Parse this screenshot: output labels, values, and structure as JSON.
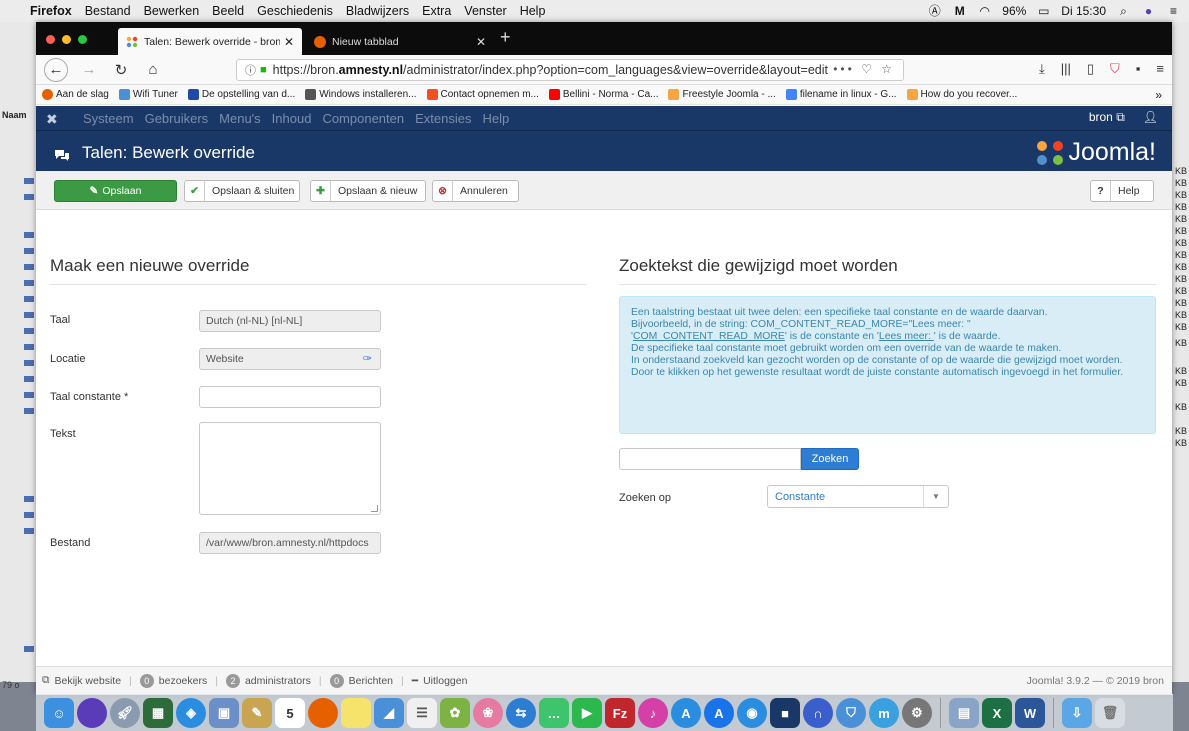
{
  "menubar": {
    "items": [
      "Firefox",
      "Bestand",
      "Bewerken",
      "Beeld",
      "Geschiedenis",
      "Bladwijzers",
      "Extra",
      "Venster",
      "Help"
    ],
    "battery": "96%",
    "clock": "Di 15:30"
  },
  "background_app": {
    "column_header": "Naam",
    "footer": "79 o",
    "right_letters": [
      "KB",
      "KB",
      "KB",
      "KB",
      "KB",
      "KB",
      "KB",
      "KB",
      "KB",
      "KB",
      "KB",
      "KB",
      "KB",
      "KB",
      "KB",
      "KB",
      "KB",
      "KB",
      "KB",
      "KB"
    ]
  },
  "browser": {
    "tabs": [
      {
        "label": "Talen: Bewerk override - bron -",
        "active": true
      },
      {
        "label": "Nieuw tabblad",
        "active": false
      }
    ],
    "url_prefix": "https://bron.",
    "url_domain": "amnesty.nl",
    "url_rest": "/administrator/index.php?option=com_languages&view=override&layout=edit",
    "bookmarks": [
      {
        "label": "Aan de slag",
        "color": "#e66000"
      },
      {
        "label": "Wifi Tuner",
        "color": "#4a8fd8"
      },
      {
        "label": "De opstelling van d...",
        "color": "#1f4aa8"
      },
      {
        "label": "Windows installeren...",
        "color": "#555555"
      },
      {
        "label": "Contact opnemen m...",
        "color": "#f25022"
      },
      {
        "label": "Bellini - Norma - Ca...",
        "color": "#ff0000"
      },
      {
        "label": "Freestyle Joomla - ...",
        "color": "#f9a541"
      },
      {
        "label": "filename in linux - G...",
        "color": "#4285f4"
      },
      {
        "label": "How do you recover...",
        "color": "#f9a541"
      }
    ]
  },
  "joomla": {
    "nav": [
      "Systeem",
      "Gebruikers",
      "Menu's",
      "Inhoud",
      "Componenten",
      "Extensies",
      "Help"
    ],
    "user": "bron",
    "page_title": "Talen: Bewerk override",
    "brand": "Joomla!",
    "toolbar": {
      "save": "Opslaan",
      "save_close": "Opslaan & sluiten",
      "save_new": "Opslaan & nieuw",
      "cancel": "Annuleren",
      "help": "Help"
    },
    "left": {
      "heading": "Maak een nieuwe override",
      "taal_label": "Taal",
      "taal_value": "Dutch (nl-NL) [nl-NL]",
      "locatie_label": "Locatie",
      "locatie_value": "Website",
      "constante_label": "Taal constante *",
      "tekst_label": "Tekst",
      "bestand_label": "Bestand",
      "bestand_value": "/var/www/bron.amnesty.nl/httpdocs"
    },
    "right": {
      "heading": "Zoektekst die gewijzigd moet worden",
      "info_line1": "Een taalstring bestaat uit twee delen: een specifieke taal constante en de waarde daarvan.",
      "info_line2": "Bijvoorbeeld, in de string: COM_CONTENT_READ_MORE=\"Lees meer: \"",
      "info_const": "COM_CONTENT_READ_MORE",
      "info_mid": "' is de constante en '",
      "info_val": "Lees meer: ",
      "info_end": "' is de waarde.",
      "info_line4": "De specifieke taal constante moet gebruikt worden om een override van de waarde te maken.",
      "info_line5": "In onderstaand zoekveld kan gezocht worden op de constante of op de waarde die gewijzigd moet worden.",
      "info_line6": "Door te klikken op het gewenste resultaat wordt de juiste constante automatisch ingevoegd in het formulier.",
      "search_button": "Zoeken",
      "search_on_label": "Zoeken op",
      "search_on_value": "Constante"
    },
    "status": {
      "view_site": "Bekijk website",
      "visitors_count": "0",
      "visitors": "bezoekers",
      "admins_count": "2",
      "admins": "administrators",
      "messages_count": "0",
      "messages": "Berichten",
      "logout": "Uitloggen",
      "copyright": "Joomla! 3.9.2  —  © 2019 bron"
    }
  },
  "dock": {
    "calendar_day": "5",
    "apps": [
      {
        "name": "finder",
        "color": "#3d8fe0"
      },
      {
        "name": "siri",
        "color": "#5a3cb8"
      },
      {
        "name": "launchpad",
        "color": "#8a9bb0"
      },
      {
        "name": "dashboard",
        "color": "#2e6b3a"
      },
      {
        "name": "safari",
        "color": "#2b8de0"
      },
      {
        "name": "preview",
        "color": "#6b8fc7"
      },
      {
        "name": "notes",
        "color": "#c9a451"
      },
      {
        "name": "calendar",
        "color": "#ffffff"
      },
      {
        "name": "firefox",
        "color": "#e66000"
      },
      {
        "name": "stickies",
        "color": "#f5e36b"
      },
      {
        "name": "scanner",
        "color": "#4a90d8"
      },
      {
        "name": "reminders",
        "color": "#f0f0f0"
      },
      {
        "name": "photos",
        "color": "#7cb342"
      },
      {
        "name": "settings-flower",
        "color": "#e67aa0"
      },
      {
        "name": "teamviewer",
        "color": "#2d7dd2"
      },
      {
        "name": "messages",
        "color": "#3ec46d"
      },
      {
        "name": "facetime",
        "color": "#2db84d"
      },
      {
        "name": "filezilla",
        "color": "#c0272d"
      },
      {
        "name": "itunes",
        "color": "#d53fa8"
      },
      {
        "name": "app-store",
        "color": "#2b8de0"
      },
      {
        "name": "app-store-2",
        "color": "#1a73e8"
      },
      {
        "name": "browser",
        "color": "#2b8de0"
      },
      {
        "name": "media",
        "color": "#1a3867"
      },
      {
        "name": "vpn",
        "color": "#3a5fcd"
      },
      {
        "name": "shield",
        "color": "#4a90d8"
      },
      {
        "name": "moneymoney",
        "color": "#3aa0e0"
      },
      {
        "name": "system-preferences",
        "color": "#777777"
      },
      {
        "name": "preview-2",
        "color": "#8aa4c8"
      },
      {
        "name": "excel",
        "color": "#1d7044"
      },
      {
        "name": "word",
        "color": "#2b579a"
      },
      {
        "name": "downloads",
        "color": "#5ba6e6"
      },
      {
        "name": "trash",
        "color": "#d8dde3"
      }
    ]
  }
}
